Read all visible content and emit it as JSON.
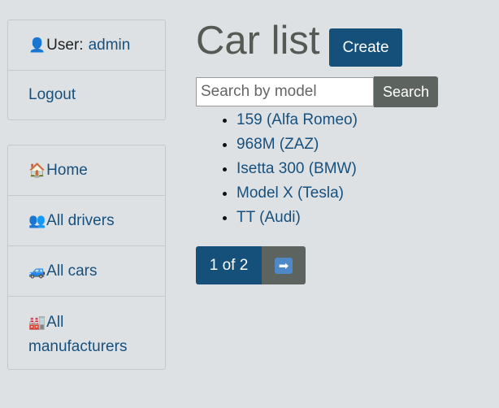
{
  "sidebar": {
    "user_label": "User:",
    "user_name": "admin",
    "user_icon": "👤",
    "logout": "Logout",
    "nav": [
      {
        "icon": "🏠",
        "icon_name": "house-icon",
        "label": "Home"
      },
      {
        "icon": "👥",
        "icon_name": "users-icon",
        "label": "All drivers"
      },
      {
        "icon": "🚙",
        "icon_name": "car-icon",
        "label": "All cars"
      },
      {
        "icon": "🏭",
        "icon_name": "factory-icon",
        "label": "All manufacturers"
      }
    ]
  },
  "header": {
    "title": "Car list",
    "create_label": "Create"
  },
  "search": {
    "placeholder": "Search by model",
    "value": "",
    "button_label": "Search"
  },
  "cars": [
    "159 (Alfa Romeo)",
    "968M (ZAZ)",
    "Isetta 300 (BMW)",
    "Model X (Tesla)",
    "TT (Audi)"
  ],
  "pagination": {
    "label": "1 of 2",
    "next_icon": "➡"
  },
  "colors": {
    "primary": "#14507a",
    "secondary": "#5d6460",
    "link": "#17507d",
    "background": "#dde1e4"
  }
}
